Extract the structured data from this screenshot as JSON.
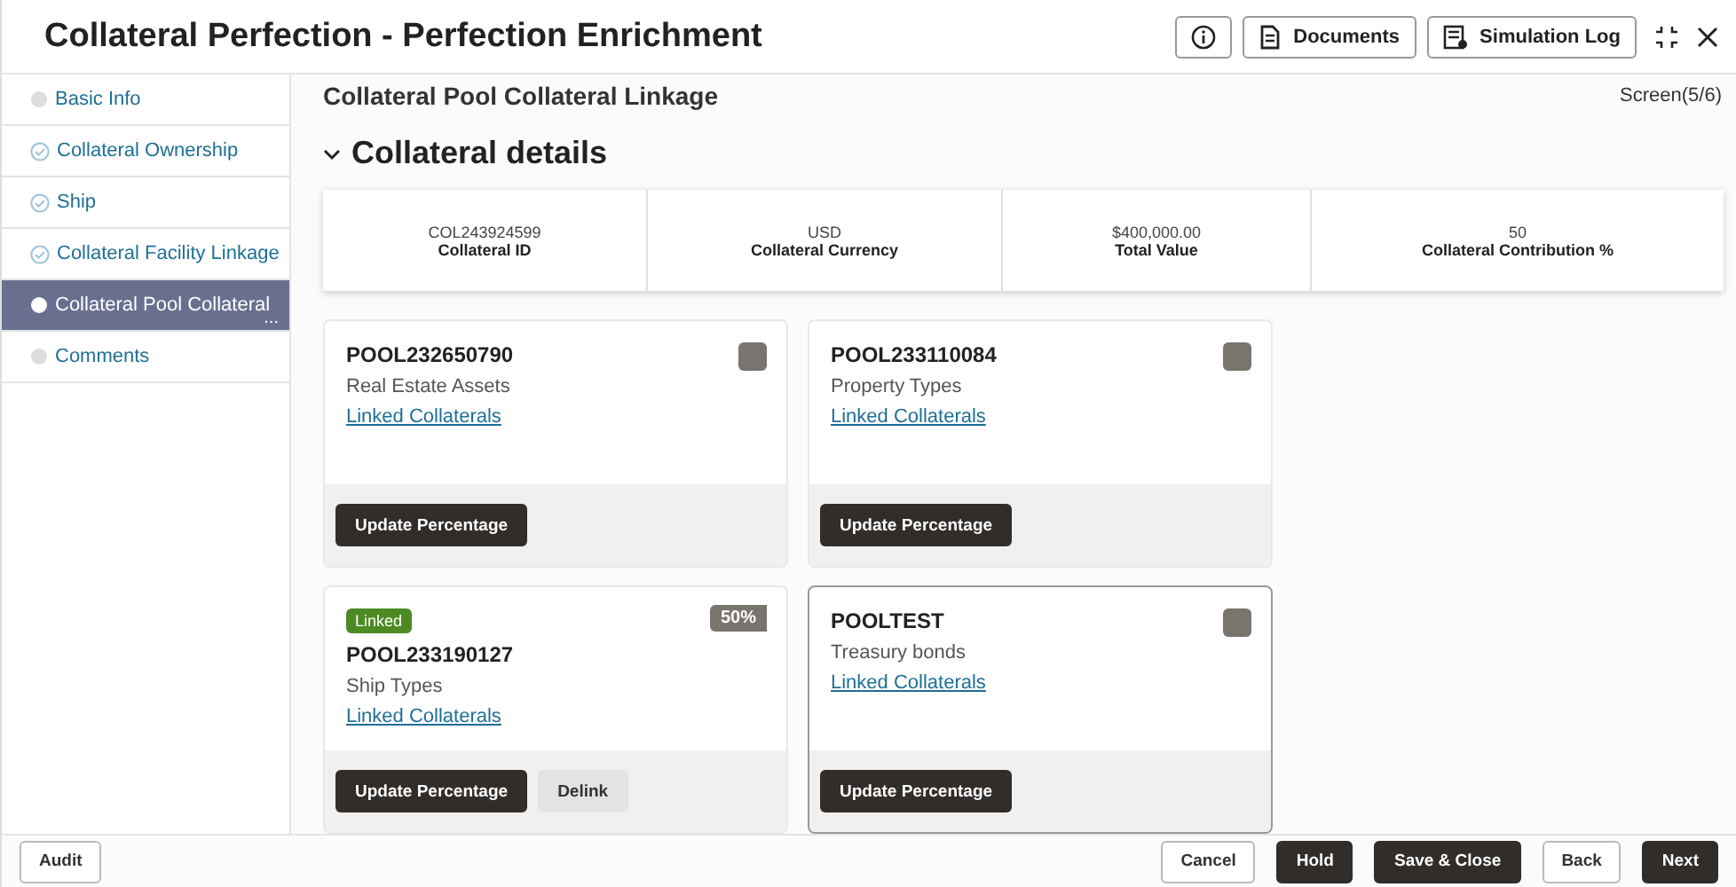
{
  "header": {
    "title": "Collateral Perfection - Perfection Enrichment",
    "buttons": [
      {
        "kind": "info"
      },
      {
        "kind": "documents",
        "label": "Documents"
      },
      {
        "kind": "log",
        "label": "Simulation Log"
      },
      {
        "kind": "collapse"
      },
      {
        "kind": "close"
      }
    ]
  },
  "sidebar": {
    "items": [
      {
        "label": "Basic Info",
        "completed": false,
        "selected": false
      },
      {
        "label": "Collateral Ownership",
        "completed": true,
        "selected": false
      },
      {
        "label": "Ship",
        "completed": true,
        "selected": false
      },
      {
        "label": "Collateral Facility Linkage",
        "completed": true,
        "selected": false
      },
      {
        "label": "Collateral Pool Collateral",
        "more": "...",
        "completed": false,
        "selected": true
      },
      {
        "label": "Comments",
        "completed": false,
        "selected": false
      }
    ]
  },
  "page": {
    "title": "Collateral Pool Collateral Linkage",
    "screen": "Screen(5/6)",
    "section": "Collateral details",
    "expanded": true
  },
  "summary": [
    {
      "value": "COL243924599",
      "label": "Collateral ID"
    },
    {
      "value": "USD",
      "label": "Collateral Currency"
    },
    {
      "value": "$400,000.00",
      "label": "Total Value"
    },
    {
      "value": "50",
      "label": "Collateral Contribution %"
    }
  ],
  "pools": [
    {
      "id": "POOL232650790",
      "type": "Real Estate Assets",
      "link": "Linked Collaterals",
      "linked": false,
      "focused": false,
      "actions": [
        "Update Percentage"
      ]
    },
    {
      "id": "POOL233110084",
      "type": "Property Types",
      "link": "Linked Collaterals",
      "linked": false,
      "focused": false,
      "actions": [
        "Update Percentage"
      ]
    },
    {
      "id": "POOL233190127",
      "type": "Ship Types",
      "link": "Linked Collaterals",
      "linked": true,
      "status": "Linked",
      "percent": "50%",
      "focused": false,
      "actions": [
        "Update Percentage",
        "Delink"
      ]
    },
    {
      "id": "POOLTEST",
      "type": "Treasury bonds",
      "link": "Linked Collaterals",
      "linked": false,
      "focused": true,
      "actions": [
        "Update Percentage"
      ]
    }
  ],
  "footer": {
    "left": [
      "Audit"
    ],
    "right": [
      {
        "label": "Cancel",
        "primary": false
      },
      {
        "label": "Hold",
        "primary": true
      },
      {
        "label": "Save & Close",
        "primary": true
      },
      {
        "label": "Back",
        "primary": false
      },
      {
        "label": "Next",
        "primary": true
      }
    ]
  }
}
